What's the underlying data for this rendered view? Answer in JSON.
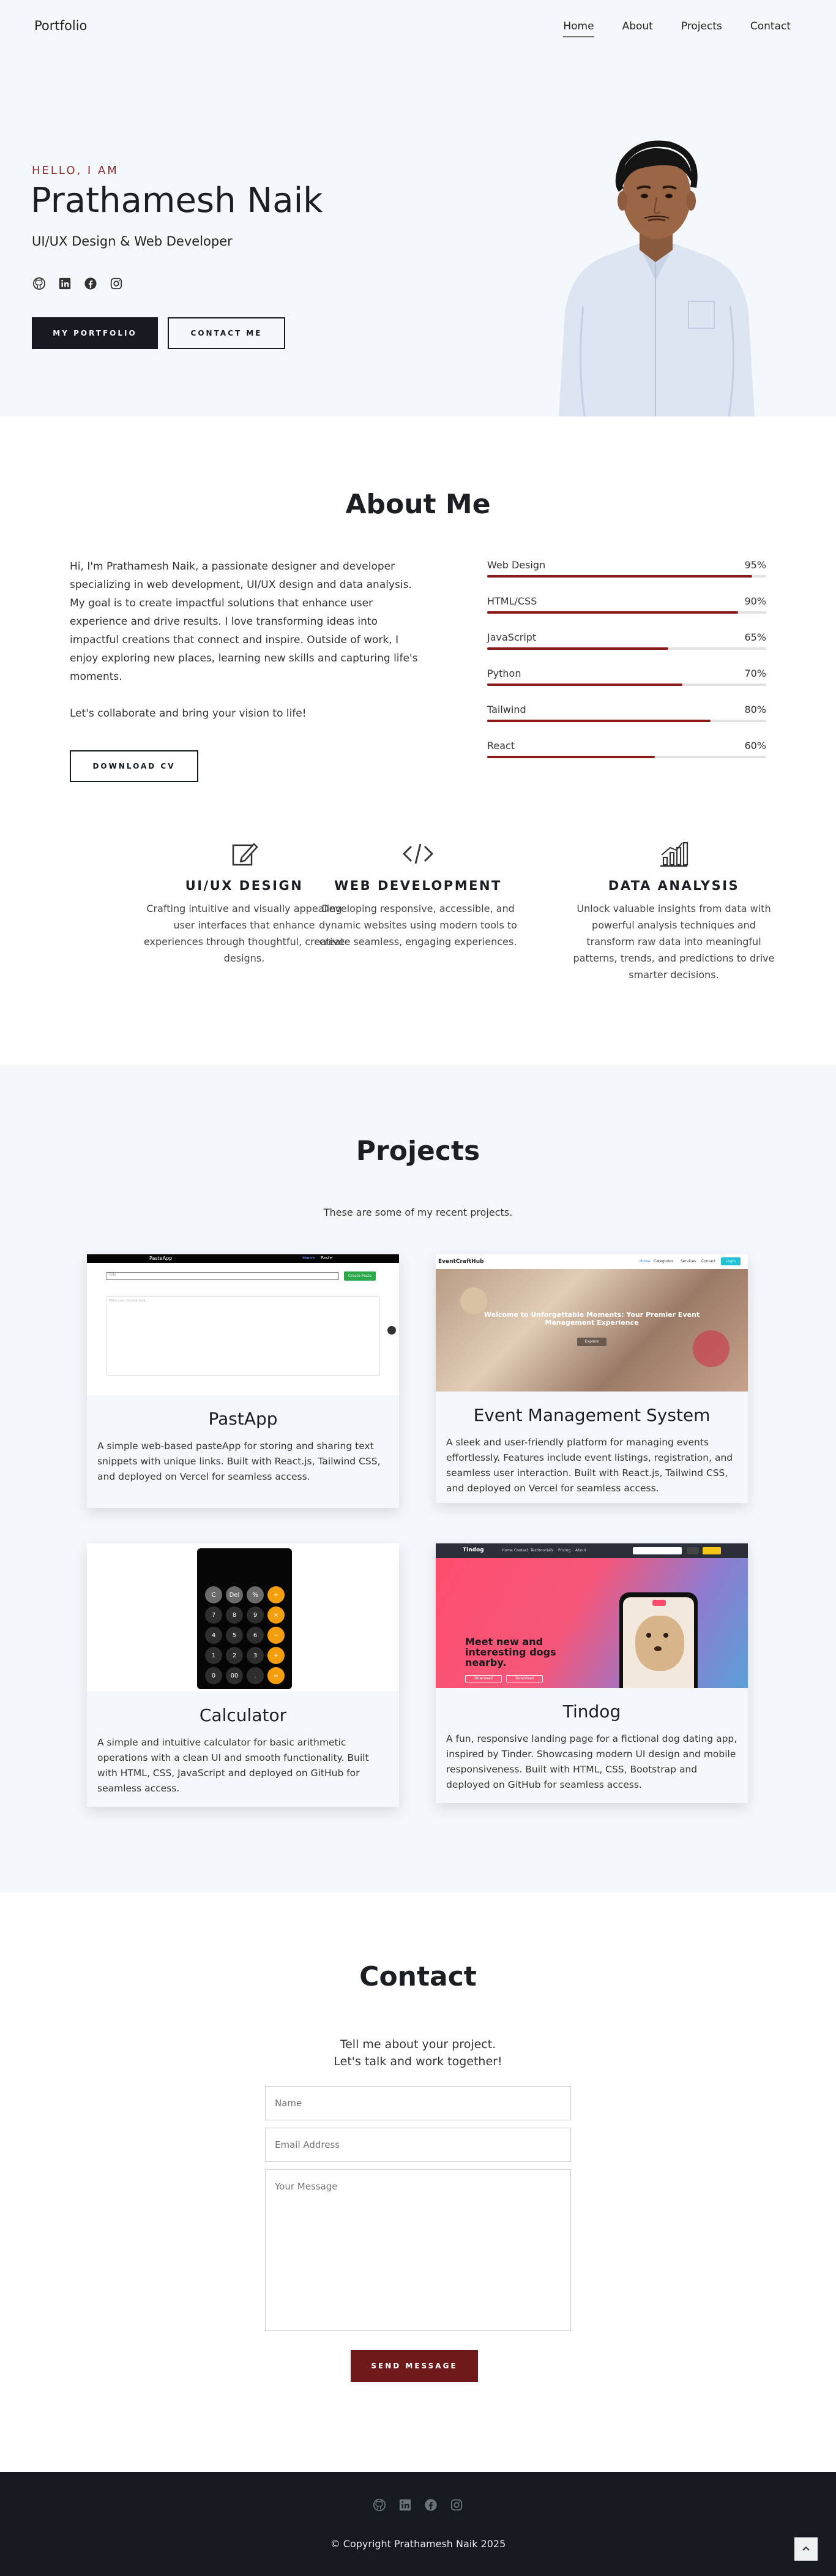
{
  "nav": {
    "brand": "Portfolio",
    "links": [
      "Home",
      "About",
      "Projects",
      "Contact"
    ]
  },
  "hero": {
    "kicker": "HELLO, I AM",
    "name": "Prathamesh Naik",
    "subtitle": "UI/UX Design & Web Developer",
    "social_icons": [
      "github-icon",
      "linkedin-icon",
      "facebook-icon",
      "instagram-icon"
    ],
    "primary_button": "MY PORTFOLIO",
    "secondary_button": "CONTACT ME"
  },
  "about": {
    "title": "About Me",
    "bio_p1": "Hi, I'm Prathamesh Naik, a passionate designer and developer specializing in web development, UI/UX design and data analysis. My goal is to create impactful solutions that enhance user experience and drive results. I love transforming ideas into impactful creations that connect and inspire. Outside of work, I enjoy exploring new places, learning new skills and capturing life's moments.",
    "bio_p2": "Let's collaborate and bring your vision to life!",
    "cv_button": "DOWNLOAD CV",
    "skills": [
      {
        "name": "Web Design",
        "percent_label": "95%",
        "level": 0.95
      },
      {
        "name": "HTML/CSS",
        "percent_label": "90%",
        "level": 0.9
      },
      {
        "name": "JavaScript",
        "percent_label": "65%",
        "level": 0.65
      },
      {
        "name": "Python",
        "percent_label": "70%",
        "level": 0.7
      },
      {
        "name": "Tailwind",
        "percent_label": "80%",
        "level": 0.8
      },
      {
        "name": "React",
        "percent_label": "60%",
        "level": 0.6
      }
    ],
    "services": [
      {
        "icon": "edit-icon",
        "title": "UI/UX DESIGN",
        "text": "Crafting intuitive and visually appealing user interfaces that enhance experiences through thoughtful, creative designs."
      },
      {
        "icon": "code-icon",
        "title": "WEB DEVELOPMENT",
        "text": "Developing responsive, accessible, and dynamic websites using modern tools to create seamless, engaging experiences."
      },
      {
        "icon": "analytics-icon",
        "title": "DATA ANALYSIS",
        "text": "Unlock valuable insights from data with powerful analysis techniques and transform raw data into meaningful patterns, trends, and predictions to drive smarter decisions."
      }
    ]
  },
  "projects": {
    "title": "Projects",
    "lead": "These are some of my recent projects.",
    "items": [
      {
        "title": "PastApp",
        "desc": "A simple web-based pasteApp for storing and sharing text snippets with unique links. Built with React.js, Tailwind CSS, and deployed on Vercel for seamless access.",
        "shot": {
          "brand": "PasteApp",
          "nav": [
            "Home",
            "Paste"
          ],
          "button": "Create Paste",
          "input_placeholder": "Title",
          "textarea_placeholder": "Write your content here..."
        }
      },
      {
        "title": "Event Management System",
        "desc": "A sleek and user-friendly platform for managing events effortlessly. Features include event listings, registration, and seamless user interaction. Built with React.js, Tailwind CSS, and deployed on Vercel for seamless access.",
        "shot": {
          "brand": "EventCraftHub",
          "nav": [
            "Home",
            "Categories",
            "Services",
            "Contact"
          ],
          "button": "Login",
          "headline": "Welcome to Unforgettable Moments: Your Premier Event Management Experience",
          "cta": "Explore"
        }
      },
      {
        "title": "Calculator",
        "desc": "A simple and intuitive calculator for basic arithmetic operations with a clean UI and smooth functionality. Built with HTML, CSS, JavaScript and deployed on GitHub for seamless access.",
        "shot": {
          "keys": [
            "C",
            "Del",
            "%",
            "÷",
            "7",
            "8",
            "9",
            "×",
            "4",
            "5",
            "6",
            "−",
            "1",
            "2",
            "3",
            "+",
            "0",
            "00",
            ".",
            "="
          ]
        }
      },
      {
        "title": "Tindog",
        "desc": "A fun, responsive landing page for a fictional dog dating app, inspired by Tinder. Showcasing modern UI design and mobile responsiveness. Built with HTML, CSS, Bootstrap and deployed on GitHub for seamless access.",
        "shot": {
          "brand": "Tindog",
          "nav": [
            "Home",
            "Contact",
            "Testimonials",
            "Pricing",
            "About"
          ],
          "headline": "Meet new and interesting dogs nearby.",
          "buttons": [
            "Download",
            "Download"
          ]
        }
      }
    ]
  },
  "contact": {
    "title": "Contact",
    "lead_line1": "Tell me about your project.",
    "lead_line2": "Let's talk and work together!",
    "name_placeholder": "Name",
    "email_placeholder": "Email Address",
    "message_placeholder": "Your Message",
    "send_button": "SEND MESSAGE"
  },
  "footer": {
    "social_icons": [
      "github-icon",
      "linkedin-icon",
      "facebook-icon",
      "instagram-icon"
    ],
    "copyright": "© Copyright Prathamesh Naik 2025",
    "back_to_top_icon": "chevron-up-icon"
  },
  "colors": {
    "accent": "#8b1c1c",
    "dark": "#141a20",
    "hero_bg": "#f5f8fb",
    "send_button": "#6e1a1a"
  }
}
